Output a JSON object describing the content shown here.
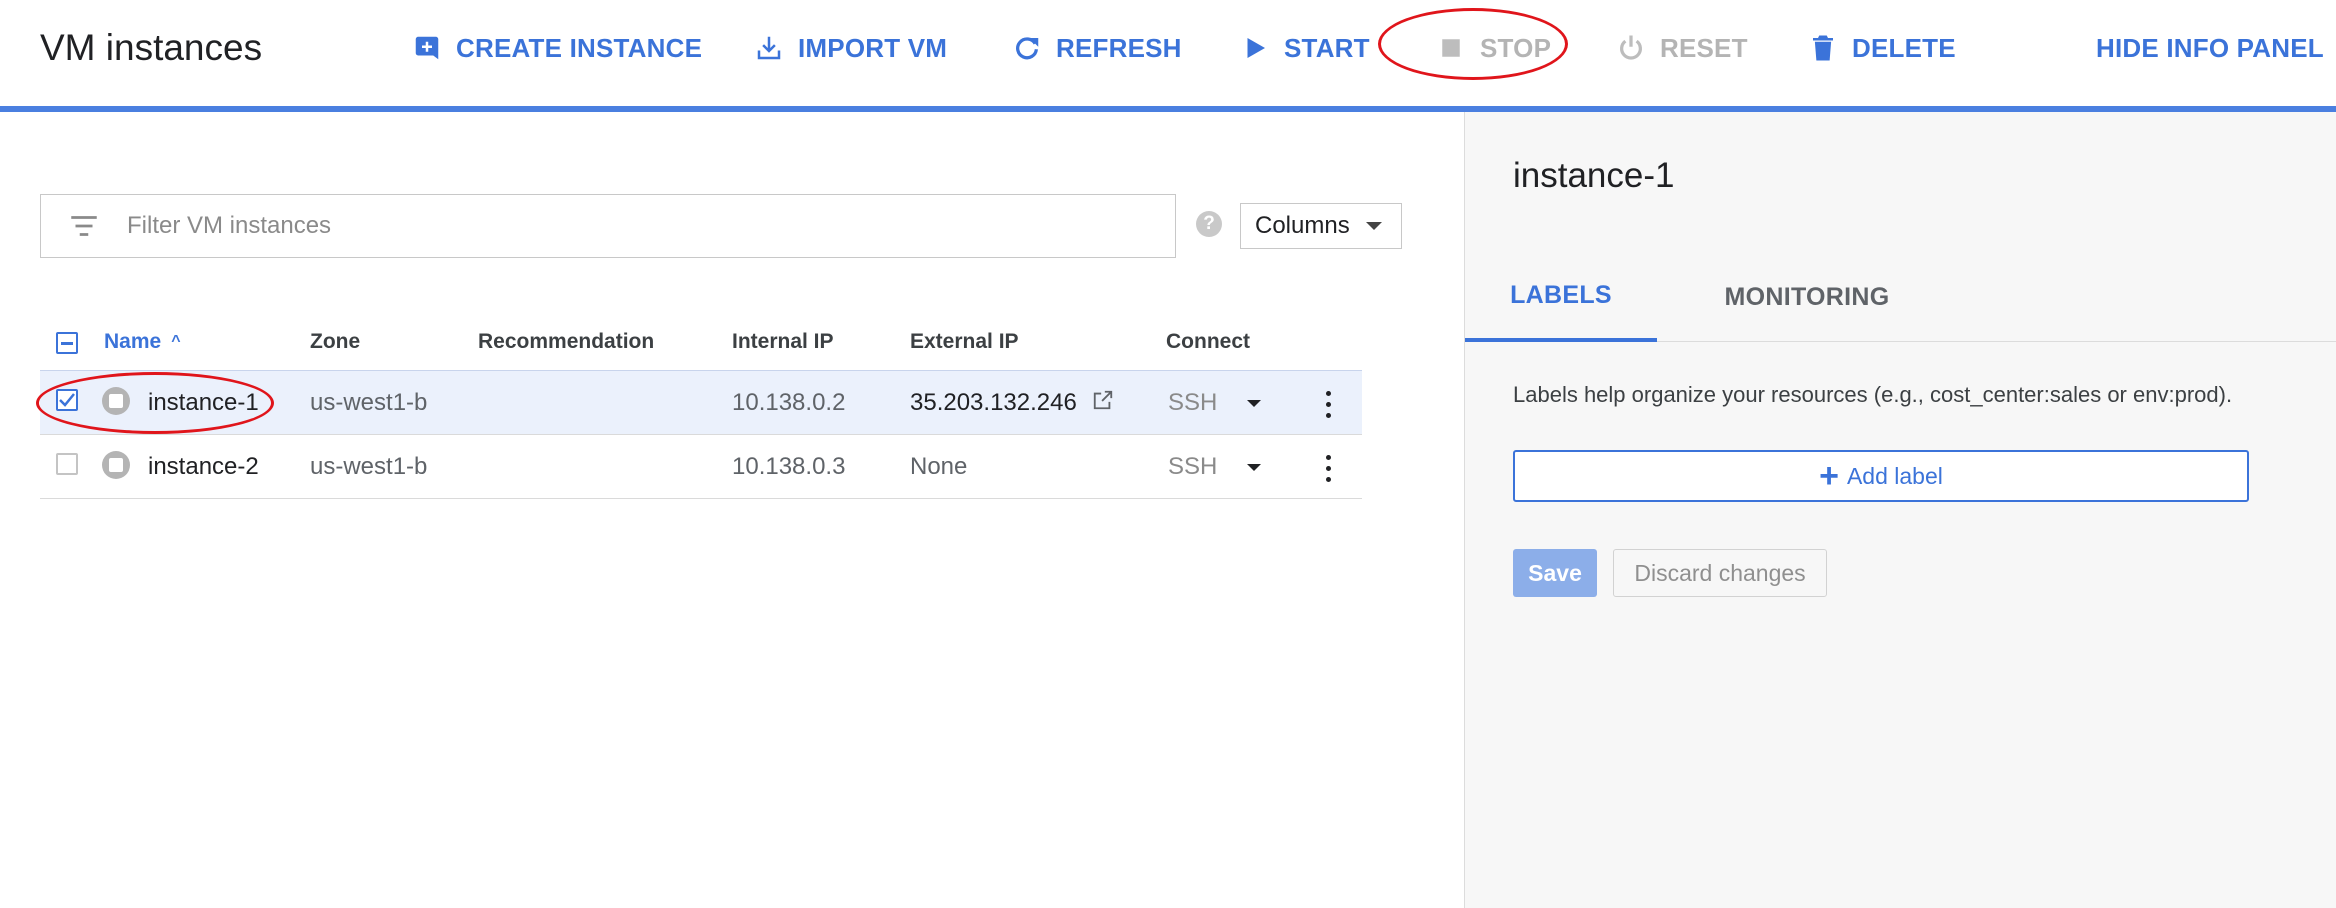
{
  "header": {
    "title": "VM instances",
    "actions": {
      "create": "CREATE INSTANCE",
      "import": "IMPORT VM",
      "refresh": "REFRESH",
      "start": "START",
      "stop": "STOP",
      "reset": "RESET",
      "delete": "DELETE",
      "hide_panel": "HIDE INFO PANEL"
    }
  },
  "filter": {
    "placeholder": "Filter VM instances",
    "help": "?"
  },
  "columns_button": "Columns",
  "table": {
    "headers": {
      "name": "Name",
      "zone": "Zone",
      "recommendation": "Recommendation",
      "internal_ip": "Internal IP",
      "external_ip": "External IP",
      "connect": "Connect"
    },
    "sort": {
      "column": "Name",
      "direction": "ascending"
    },
    "rows": [
      {
        "name": "instance-1",
        "zone": "us-west1-b",
        "recommendation": "",
        "internal_ip": "10.138.0.2",
        "external_ip": "35.203.132.246",
        "connect": "SSH",
        "selected": true,
        "status": "stopped"
      },
      {
        "name": "instance-2",
        "zone": "us-west1-b",
        "recommendation": "",
        "internal_ip": "10.138.0.3",
        "external_ip": "None",
        "connect": "SSH",
        "selected": false,
        "status": "stopped"
      }
    ]
  },
  "info_panel": {
    "title": "instance-1",
    "tabs": {
      "labels": "LABELS",
      "monitoring": "MONITORING"
    },
    "active_tab": "LABELS",
    "description": "Labels help organize your resources (e.g., cost_center:sales or env:prod).",
    "add_label": "Add label",
    "save": "Save",
    "discard": "Discard changes"
  },
  "colors": {
    "accent": "#3b73d9",
    "annotation": "#e0151b",
    "disabled": "#b4b4b4",
    "selected_row": "#ebf1fc",
    "toolbar_rule": "#4a7fe0"
  },
  "icons": {
    "create": "add-box-icon",
    "import": "download-icon",
    "refresh": "refresh-icon",
    "start": "play-icon",
    "stop": "stop-square-icon",
    "reset": "power-icon",
    "delete": "trash-icon",
    "filter": "filter-lines-icon",
    "external_link": "external-link-icon",
    "row_menu": "kebab-menu-icon"
  }
}
